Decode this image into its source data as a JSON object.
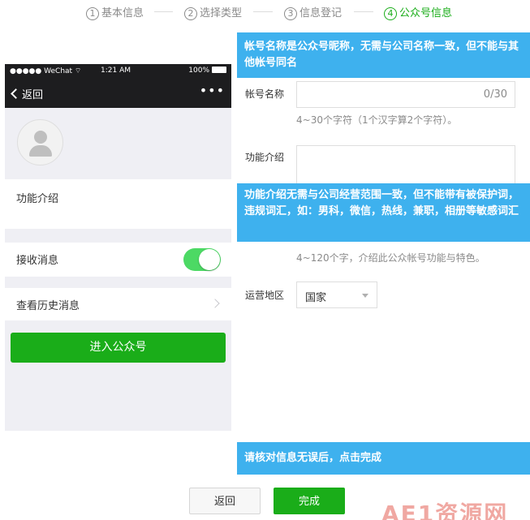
{
  "steps": [
    {
      "num": "1",
      "label": "基本信息",
      "active": false
    },
    {
      "num": "2",
      "label": "选择类型",
      "active": false
    },
    {
      "num": "3",
      "label": "信息登记",
      "active": false
    },
    {
      "num": "4",
      "label": "公众号信息",
      "active": true
    }
  ],
  "phone": {
    "status": {
      "carrier": "●●●●● WeChat ⌔",
      "time": "1:21 AM",
      "battery": "100%"
    },
    "nav": {
      "back_label": "返回",
      "more": "•••"
    },
    "intro_label": "功能介绍",
    "receive_label": "接收消息",
    "receive_on": true,
    "history_label": "查看历史消息",
    "enter_label": "进入公众号"
  },
  "tips": {
    "name_tip": "帐号名称是公众号昵称，无需与公司名称一致，但不能与其他帐号同名",
    "intro_tip": "功能介绍无需与公司经营范围一致，但不能带有被保护词，违规词汇，如：男科，微信，热线，兼职，相册等敏感词汇",
    "confirm_tip": "请核对信息无误后，点击完成"
  },
  "form": {
    "name_label": "帐号名称",
    "name_counter": "0/30",
    "name_hint": "4~30个字符（1个汉字算2个字符）。",
    "intro_label": "功能介绍",
    "intro_hint": "4~120个字，介绍此公众帐号功能与特色。",
    "region_label": "运营地区",
    "region_value": "国家"
  },
  "buttons": {
    "back": "返回",
    "done": "完成"
  },
  "watermark": "AE1资源网",
  "colors": {
    "accent_green": "#1aad19",
    "tip_blue": "#3eb1ee",
    "toggle_green": "#4cd964"
  }
}
